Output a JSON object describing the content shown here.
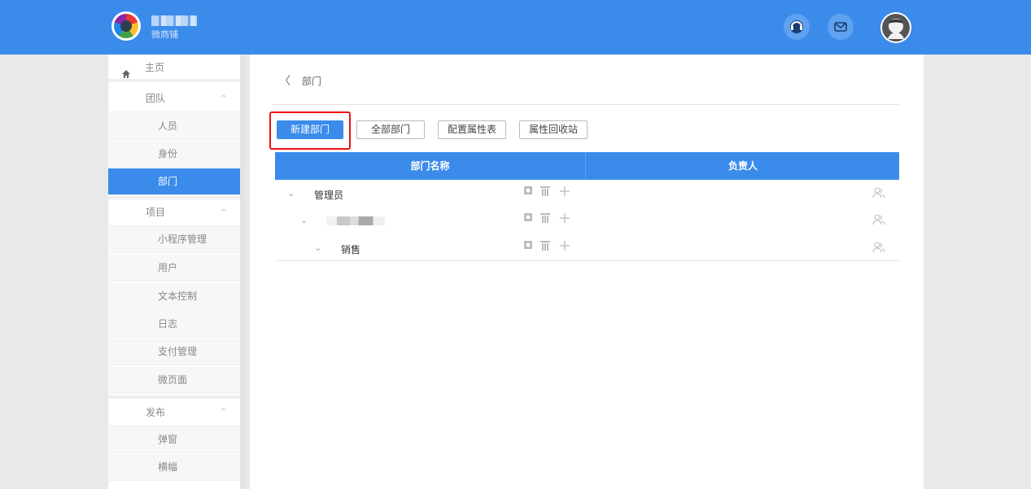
{
  "header": {
    "brand_text": "微商铺",
    "icons": [
      "support-icon",
      "mail-icon",
      "user-avatar"
    ]
  },
  "sidebar": {
    "home": "主页",
    "groups": [
      {
        "label": "团队",
        "caret": "^",
        "items": [
          "人员",
          "身份",
          "部门"
        ],
        "active": "部门"
      },
      {
        "label": "项目",
        "caret": "^",
        "items": [
          "小程序管理",
          "用户",
          "文本控制",
          "日志",
          "支付管理",
          "微页面"
        ]
      },
      {
        "label": "发布",
        "caret": "^",
        "items": [
          "弹窗",
          "横幅"
        ]
      }
    ]
  },
  "breadcrumb": {
    "back": "〈",
    "label": "部门"
  },
  "toolbar": {
    "new_dept": "新建部门",
    "all_dept": "全部部门",
    "config_table": "配置属性表",
    "recycle_bin": "属性回收站"
  },
  "table": {
    "headers": [
      "部门名称",
      "负责人"
    ],
    "rows": [
      {
        "name": "管理员",
        "level": 0,
        "toggle": "⌄"
      },
      {
        "name": "",
        "level": 1,
        "toggle": "⌄",
        "obscured": true
      },
      {
        "name": "销售",
        "level": 2,
        "toggle": "⌄"
      }
    ]
  },
  "colors": {
    "accent": "#3b8beb",
    "highlight": "#e11111"
  }
}
